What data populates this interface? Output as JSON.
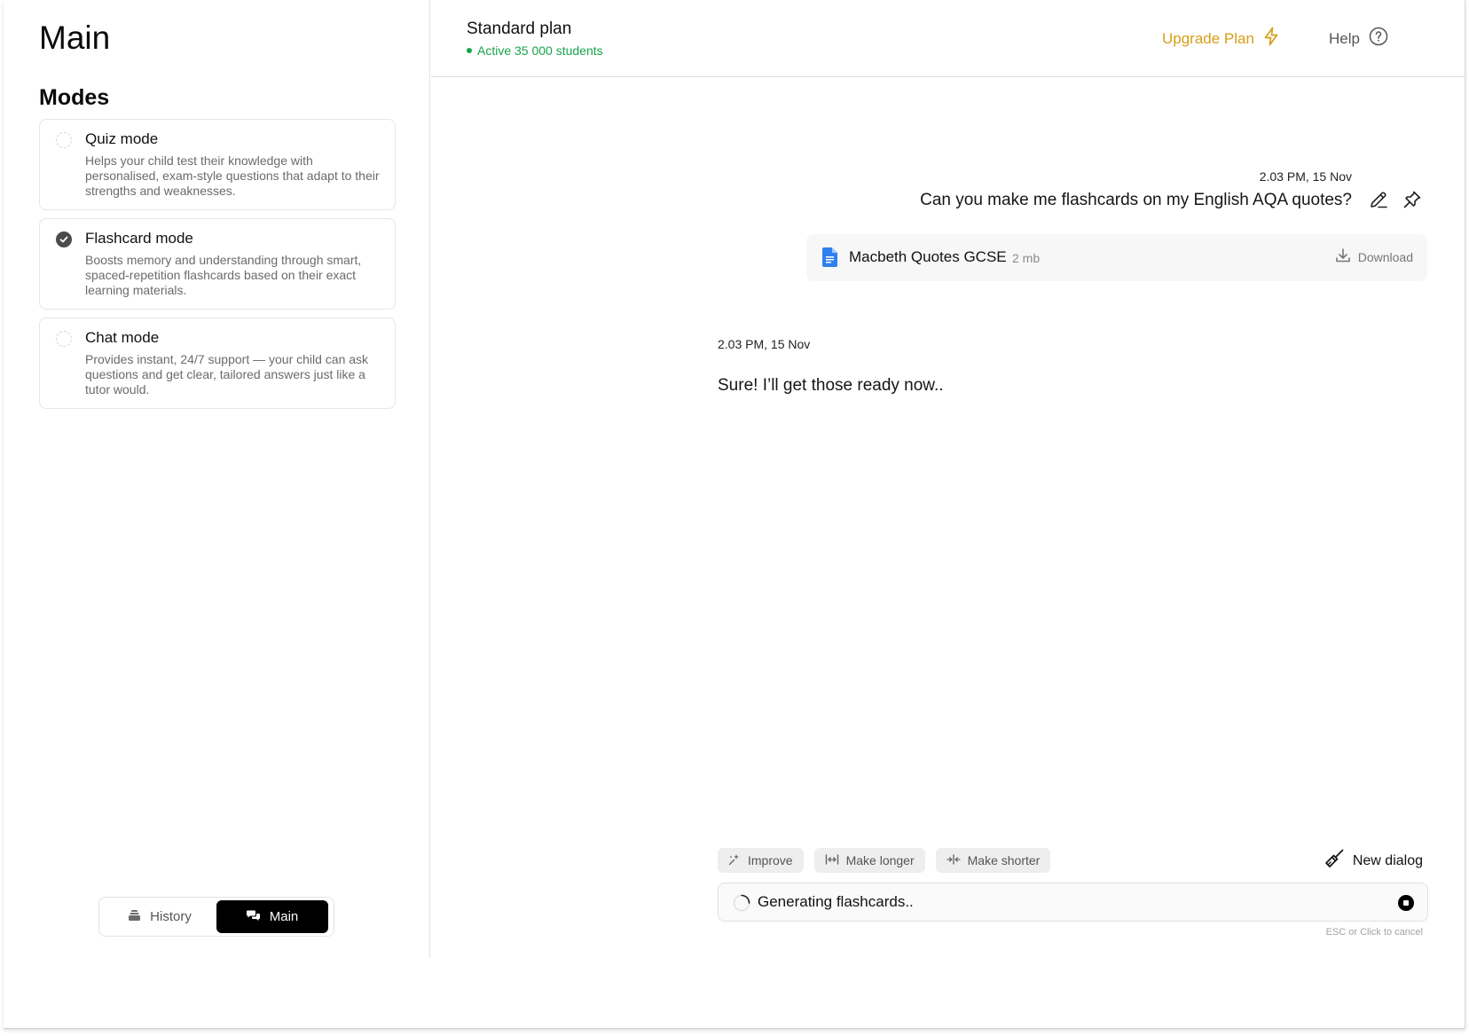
{
  "sidebar": {
    "title": "Main",
    "modes_title": "Modes",
    "modes": [
      {
        "title": "Quiz mode",
        "description": "Helps your child test their knowledge with personalised, exam-style questions that adapt to their strengths and weaknesses.",
        "selected": false
      },
      {
        "title": "Flashcard mode",
        "description": "Boosts memory and understanding through smart, spaced-repetition flashcards based on their exact learning materials.",
        "selected": true
      },
      {
        "title": "Chat mode",
        "description": "Provides instant, 24/7 support — your child can ask questions and get clear, tailored answers just like a tutor would.",
        "selected": false
      }
    ],
    "nav": {
      "history_label": "History",
      "main_label": "Main",
      "active": "Main"
    }
  },
  "header": {
    "plan_name": "Standard plan",
    "plan_status": "Active 35 000 students",
    "upgrade_label": "Upgrade Plan",
    "help_label": "Help"
  },
  "chat": {
    "user_message": {
      "time": "2.03 PM, 15 Nov",
      "text": "Can you make me flashcards on my English AQA quotes?"
    },
    "attachment": {
      "name": "Macbeth Quotes GCSE",
      "size": "2 mb",
      "download_label": "Download"
    },
    "ai_message": {
      "time": "2.03 PM, 15 Nov",
      "text": "Sure! I’ll get those ready now.."
    },
    "chips": [
      "Improve",
      "Make longer",
      "Make shorter"
    ],
    "new_dialog_label": "New dialog",
    "input_status": "Generating flashcards..",
    "cancel_hint": "ESC or Click to cancel"
  },
  "colors": {
    "accent": "#d69e16",
    "status_green": "#16a34a",
    "file_blue": "#2f80ed",
    "active_nav": "#000000"
  },
  "icons": {
    "upgrade": "lightning-icon",
    "help": "question-circle-icon",
    "edit": "pencil-icon",
    "pin": "pin-icon",
    "file": "document-icon",
    "download": "download-icon",
    "improve": "sparkle-icon",
    "longer": "expand-horizontal-icon",
    "shorter": "compress-horizontal-icon",
    "new_dialog": "broom-icon",
    "history": "stack-icon",
    "main": "chat-bubbles-icon"
  }
}
